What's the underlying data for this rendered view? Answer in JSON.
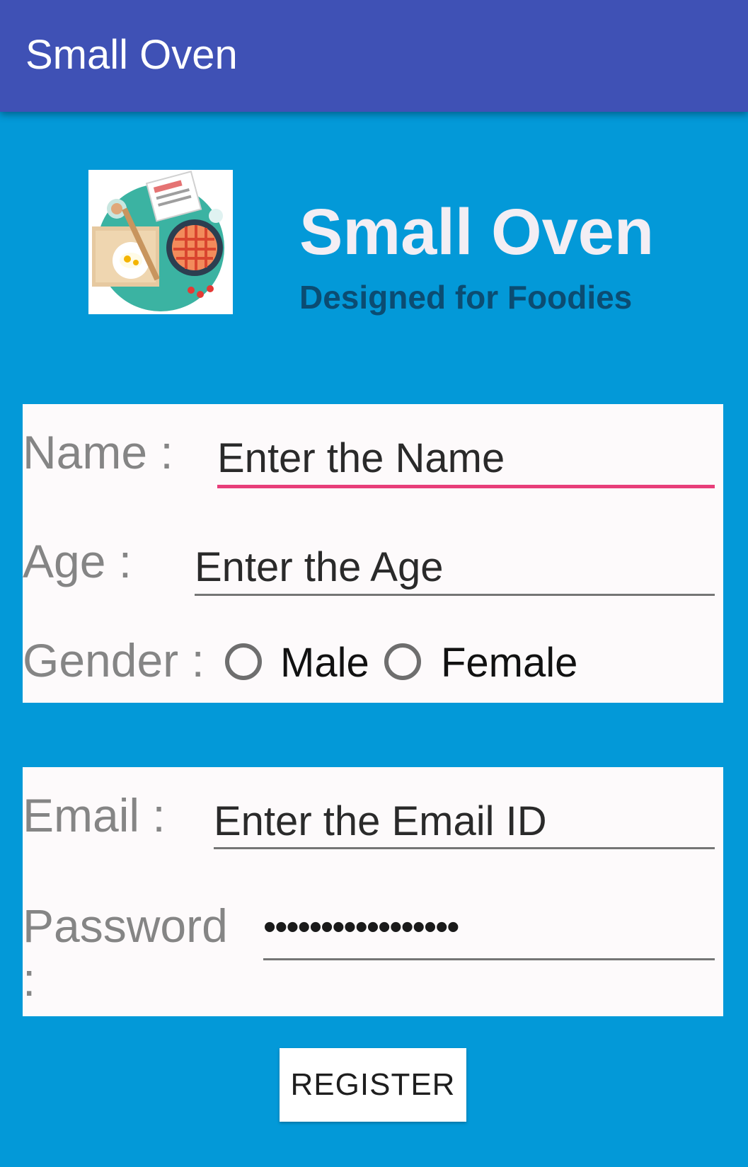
{
  "appbar": {
    "title": "Small Oven"
  },
  "brand": {
    "title": "Small Oven",
    "subtitle": "Designed for Foodies"
  },
  "form": {
    "name": {
      "label": "Name :",
      "placeholder": "Enter the Name"
    },
    "age": {
      "label": "Age :",
      "placeholder": "Enter the Age"
    },
    "gender": {
      "label": "Gender :",
      "options": [
        "Male",
        "Female"
      ]
    },
    "email": {
      "label": "Email :",
      "placeholder": "Enter the Email ID"
    },
    "password": {
      "label_line1": "Password",
      "label_line2": ":",
      "value": "•••••••••••••••••"
    }
  },
  "register_label": "REGISTER",
  "colors": {
    "appbar": "#3f51b5",
    "background": "#0399d8",
    "accent": "#e83e7a"
  }
}
